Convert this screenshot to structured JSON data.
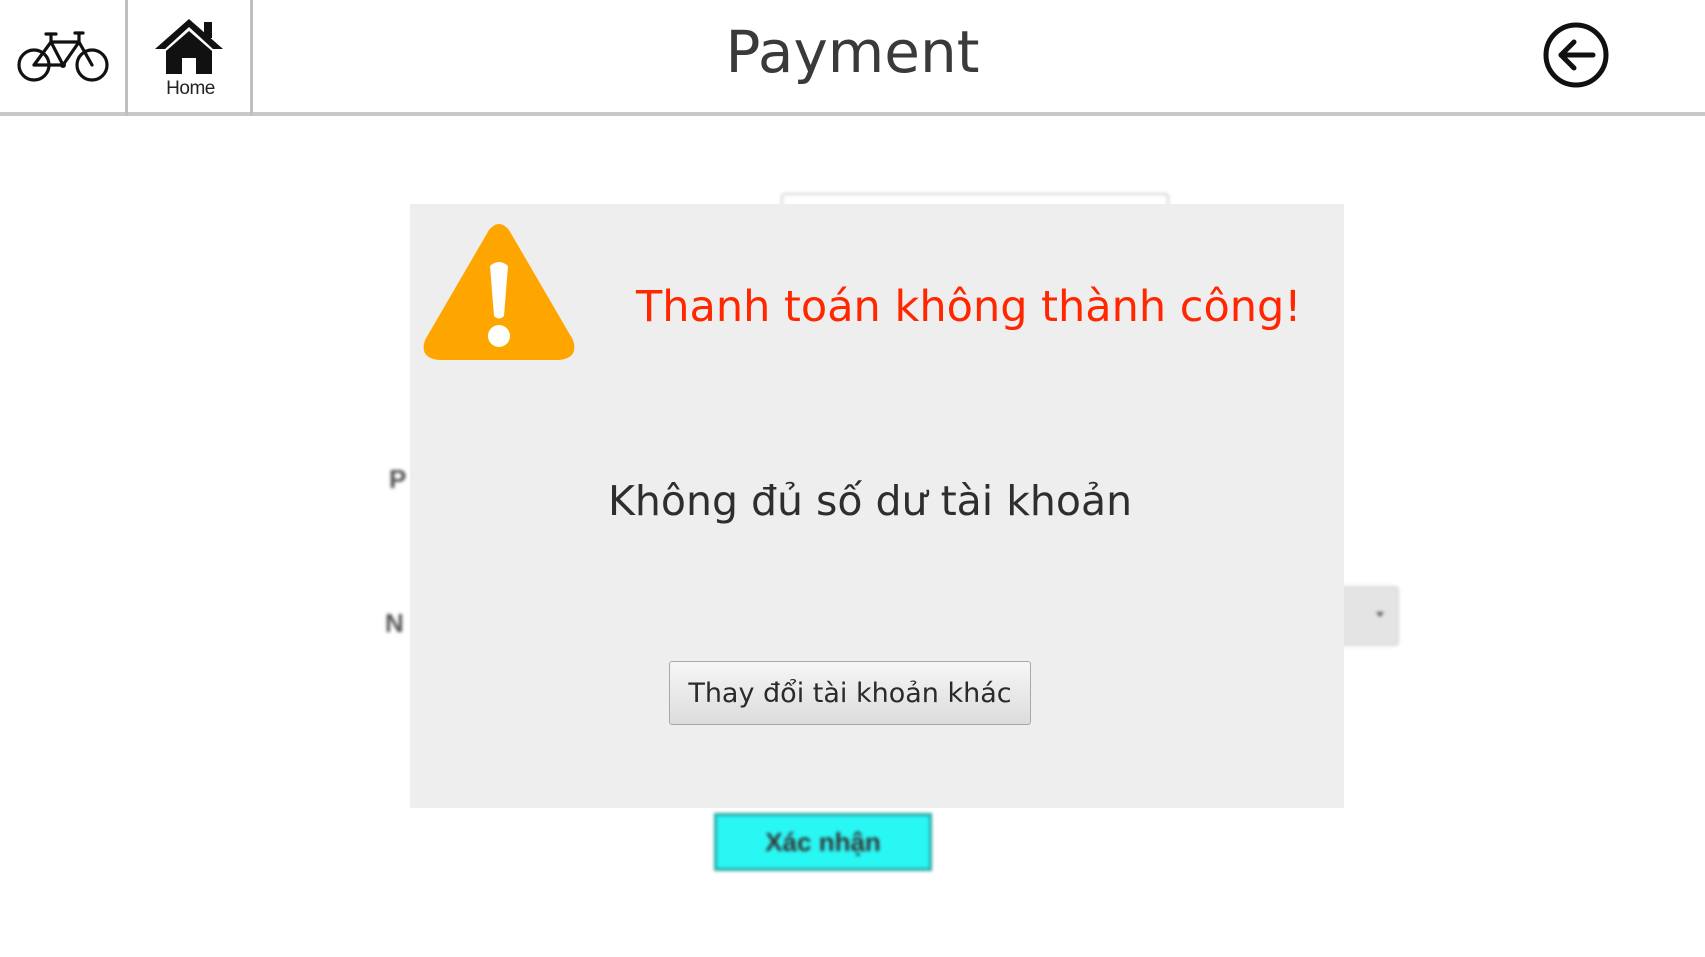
{
  "header": {
    "title": "Payment",
    "home_label": "Home",
    "icons": {
      "bike": "bicycle-icon",
      "home": "home-icon",
      "back": "back-arrow-icon"
    }
  },
  "background_form": {
    "label_1": "P",
    "label_2": "N",
    "confirm_label": "Xác nhận"
  },
  "dialog": {
    "icon": "warning-icon",
    "title": "Thanh toán không thành công!",
    "message": "Không đủ số dư tài khoản",
    "action_label": "Thay đổi tài khoản khác"
  },
  "colors": {
    "dialog_title": "#ff2600",
    "warning": "#ffa500",
    "confirm_button": "#29f7f4",
    "dialog_bg": "#eeeeee"
  }
}
